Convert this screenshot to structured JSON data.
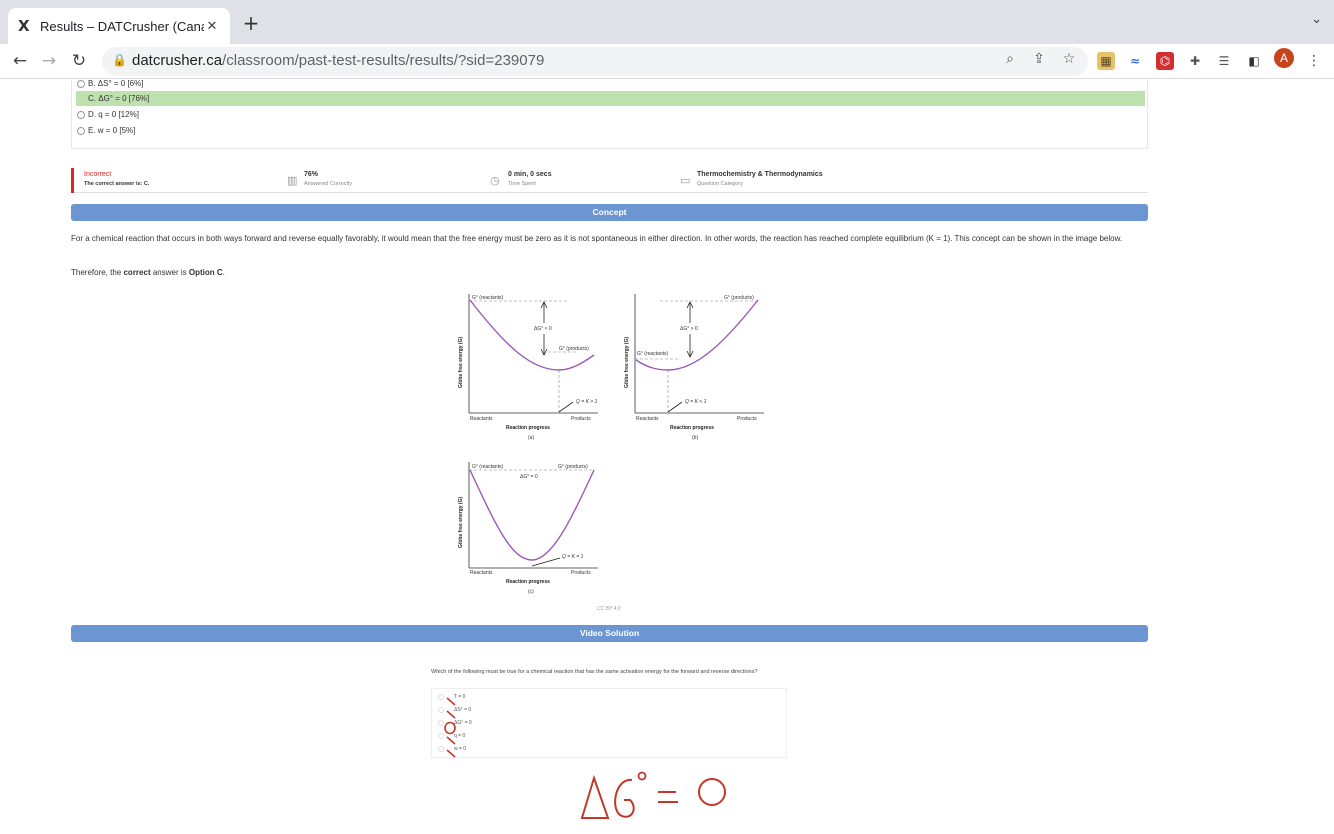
{
  "browser": {
    "tab_title": "Results – DATCrusher (Canadia",
    "favicon": "X",
    "close_glyph": "✕",
    "new_tab_glyph": "+",
    "url_host": "datcrusher.ca",
    "url_path": "/classroom/past-test-results/results/?sid=239079",
    "avatar_letter": "A"
  },
  "question": {
    "options": [
      {
        "label": "B. ΔS° = 0 [6%]",
        "correct": false
      },
      {
        "label": "C. ΔG° = 0 [76%]",
        "correct": true
      },
      {
        "label": "D. q = 0 [12%]",
        "correct": false
      },
      {
        "label": "E. w = 0 [5%]",
        "correct": false
      }
    ]
  },
  "status": {
    "result": "Incorrect",
    "correct_answer": "The correct answer is: C.",
    "percent": "76%",
    "percent_label": "Answered Correctly",
    "time": "0 min, 0 secs",
    "time_label": "Time Spent",
    "category": "Thermochemistry & Thermodynamics",
    "category_label": "Question Category"
  },
  "concept": {
    "heading": "Concept",
    "paragraph": "For a chemical reaction that occurs in both ways forward and reverse equally favorably, it would mean that the free energy must be zero as it is not spontaneous in either direction. In other words, the reaction has reached complete equilibrium (K = 1). This concept can be shown in the image below.",
    "conclusion_pre": "Therefore, the ",
    "conclusion_bold1": "correct",
    "conclusion_mid": " answer is ",
    "conclusion_bold2": "Option C",
    "conclusion_post": "."
  },
  "figure": {
    "ylabel": "Gibbs free energy (G)",
    "xlabel": "Reaction progress",
    "reactants": "Reactants",
    "products": "Products",
    "a": {
      "tag": "(a)",
      "top": "G° (reactants)",
      "low": "G° (products)",
      "delta": "ΔG° < 0",
      "q": "Q = K > 1"
    },
    "b": {
      "tag": "(b)",
      "top": "G° (products)",
      "low": "G° (reactants)",
      "delta": "ΔG° > 0",
      "q": "Q = K < 1"
    },
    "c": {
      "tag": "(c)",
      "left": "G° (reactants)",
      "right": "G° (products)",
      "delta": "ΔG° = 0",
      "q": "Q = K = 1"
    },
    "credit": "CC BY 4.0"
  },
  "video": {
    "heading": "Video Solution",
    "question": "Which of the following must be true for a chemical reaction that has the same activation energy for the forward and reverse directions?",
    "options": [
      "T = 0",
      "ΔS° = 0",
      "ΔG° = 0",
      "q = 0",
      "w = 0"
    ],
    "handwriting": "ΔG° = 0"
  }
}
